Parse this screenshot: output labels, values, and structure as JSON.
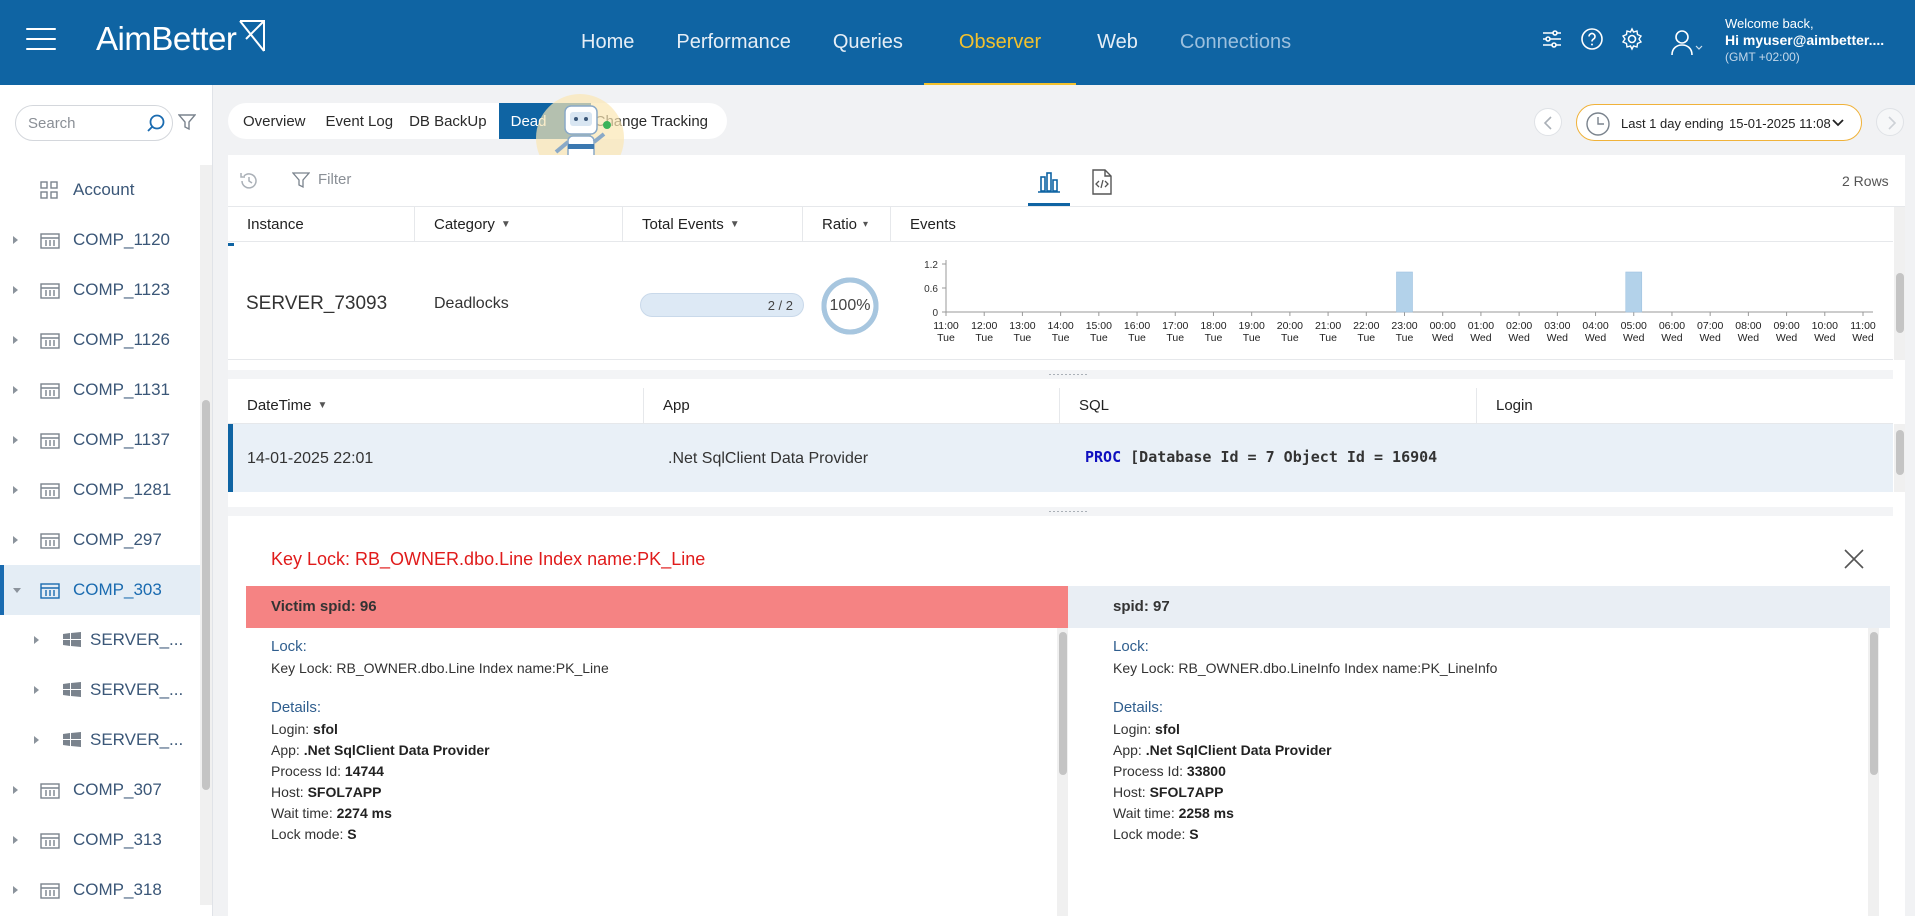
{
  "app": {
    "brand": "AimBetter"
  },
  "nav": {
    "items": [
      "Home",
      "Performance",
      "Queries",
      "Observer",
      "Web",
      "Connections"
    ],
    "active": "Observer"
  },
  "user": {
    "welcome": "Welcome back,",
    "hi": "Hi myuser@aimbetter....",
    "timezone": "(GMT +02:00)"
  },
  "sidebar": {
    "search_placeholder": "Search",
    "account_label": "Account",
    "items": [
      {
        "label": "COMP_1120",
        "level": 0,
        "state": "collapsed"
      },
      {
        "label": "COMP_1123",
        "level": 0,
        "state": "collapsed"
      },
      {
        "label": "COMP_1126",
        "level": 0,
        "state": "collapsed"
      },
      {
        "label": "COMP_1131",
        "level": 0,
        "state": "collapsed"
      },
      {
        "label": "COMP_1137",
        "level": 0,
        "state": "collapsed"
      },
      {
        "label": "COMP_1281",
        "level": 0,
        "state": "collapsed"
      },
      {
        "label": "COMP_297",
        "level": 0,
        "state": "collapsed"
      },
      {
        "label": "COMP_303",
        "level": 0,
        "state": "expanded",
        "selected": true
      },
      {
        "label": "SERVER_...",
        "level": 1,
        "state": "collapsed"
      },
      {
        "label": "SERVER_...",
        "level": 1,
        "state": "collapsed"
      },
      {
        "label": "SERVER_...",
        "level": 1,
        "state": "collapsed"
      },
      {
        "label": "COMP_307",
        "level": 0,
        "state": "collapsed"
      },
      {
        "label": "COMP_313",
        "level": 0,
        "state": "collapsed"
      },
      {
        "label": "COMP_318",
        "level": 0,
        "state": "collapsed"
      }
    ]
  },
  "subtabs": {
    "items": [
      "Overview",
      "Event Log",
      "DB BackUp",
      "Dead",
      "Change Tracking"
    ],
    "active": "Dead"
  },
  "time_range": {
    "label": "Last 1 day ending",
    "date": "15-01-2025 11:08"
  },
  "toolbar": {
    "filter_placeholder": "Filter",
    "row_count": "2 Rows"
  },
  "grid": {
    "columns": [
      "Instance",
      "Category",
      "Total Events",
      "Ratio",
      "Events"
    ],
    "row": {
      "instance": "SERVER_73093",
      "category": "Deadlocks",
      "total_events": "2 / 2",
      "total_fraction": 1.0,
      "ratio": "100%"
    }
  },
  "chart_data": {
    "type": "bar",
    "y_ticks": [
      "1.2",
      "0.6",
      "0"
    ],
    "ylim": [
      0,
      1.2
    ],
    "categories": [
      [
        "11:00",
        "Tue"
      ],
      [
        "12:00",
        "Tue"
      ],
      [
        "13:00",
        "Tue"
      ],
      [
        "14:00",
        "Tue"
      ],
      [
        "15:00",
        "Tue"
      ],
      [
        "16:00",
        "Tue"
      ],
      [
        "17:00",
        "Tue"
      ],
      [
        "18:00",
        "Tue"
      ],
      [
        "19:00",
        "Tue"
      ],
      [
        "20:00",
        "Tue"
      ],
      [
        "21:00",
        "Tue"
      ],
      [
        "22:00",
        "Tue"
      ],
      [
        "23:00",
        "Tue"
      ],
      [
        "00:00",
        "Wed"
      ],
      [
        "01:00",
        "Wed"
      ],
      [
        "02:00",
        "Wed"
      ],
      [
        "03:00",
        "Wed"
      ],
      [
        "04:00",
        "Wed"
      ],
      [
        "05:00",
        "Wed"
      ],
      [
        "06:00",
        "Wed"
      ],
      [
        "07:00",
        "Wed"
      ],
      [
        "08:00",
        "Wed"
      ],
      [
        "09:00",
        "Wed"
      ],
      [
        "10:00",
        "Wed"
      ],
      [
        "11:00",
        "Wed"
      ]
    ],
    "values": [
      0,
      0,
      0,
      0,
      0,
      0,
      0,
      0,
      0,
      0,
      0,
      0,
      1,
      0,
      0,
      0,
      0,
      0,
      1,
      0,
      0,
      0,
      0,
      0,
      0
    ],
    "bar_color": "#b3d2ea"
  },
  "events": {
    "columns": [
      "DateTime",
      "App",
      "SQL",
      "Login"
    ],
    "row": {
      "datetime": "14-01-2025 22:01",
      "app": ".Net SqlClient Data Provider",
      "sql_keyword": "PROC",
      "sql_rest": " [Database Id = 7 Object Id = 16904",
      "login": ""
    }
  },
  "detail": {
    "title": "Key Lock: RB_OWNER.dbo.Line Index name:PK_Line",
    "victim": {
      "header": "Victim spid: 96",
      "lock_label": "Lock:",
      "lock": "Key Lock: RB_OWNER.dbo.Line Index name:PK_Line",
      "details_label": "Details:",
      "login_label": "Login:",
      "login": "sfol",
      "app_label": "App:",
      "app": ".Net SqlClient Data Provider",
      "pid_label": "Process Id:",
      "pid": "14744",
      "host_label": "Host:",
      "host": "SFOL7APP",
      "wait_label": "Wait time:",
      "wait": "2274 ms",
      "mode_label": "Lock mode:",
      "mode": "S"
    },
    "other": {
      "header": "spid: 97",
      "lock_label": "Lock:",
      "lock": "Key Lock: RB_OWNER.dbo.LineInfo Index name:PK_LineInfo",
      "details_label": "Details:",
      "login_label": "Login:",
      "login": "sfol",
      "app_label": "App:",
      "app": ".Net SqlClient Data Provider",
      "pid_label": "Process Id:",
      "pid": "33800",
      "host_label": "Host:",
      "host": "SFOL7APP",
      "wait_label": "Wait time:",
      "wait": "2258 ms",
      "mode_label": "Lock mode:",
      "mode": "S"
    }
  },
  "colors": {
    "primary": "#0f64a3",
    "accent": "#f3c12d",
    "victim": "#f58383",
    "error_text": "#e01b1b"
  }
}
